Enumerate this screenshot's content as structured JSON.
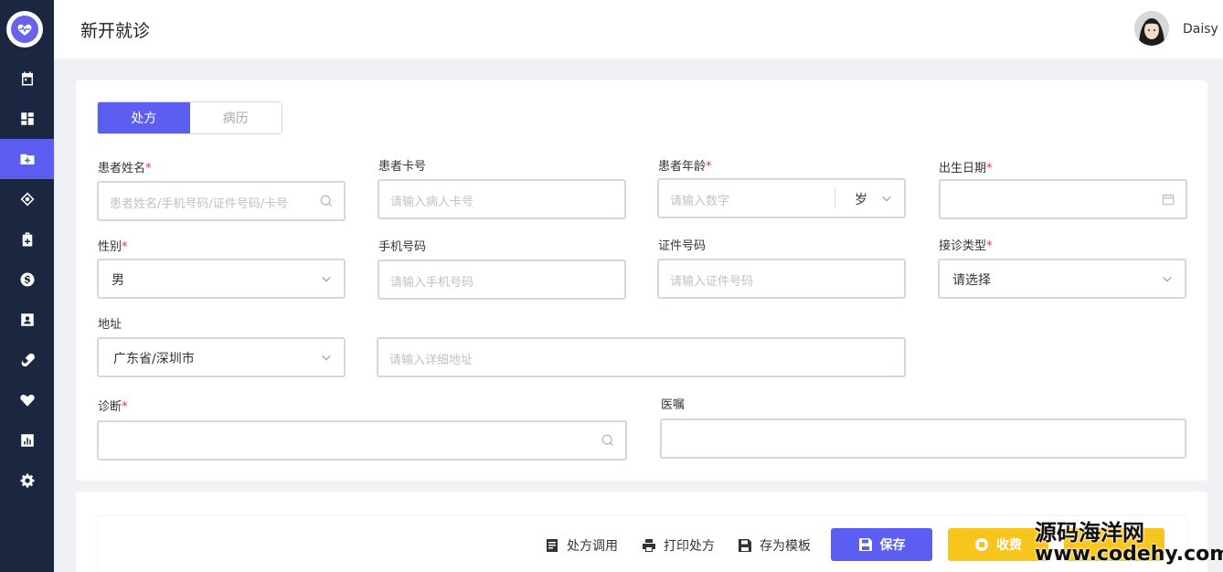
{
  "header": {
    "title": "新开就诊",
    "username": "Daisy"
  },
  "sidebar": {
    "items": [
      {
        "icon": "calendar-icon"
      },
      {
        "icon": "dashboard-icon"
      },
      {
        "icon": "folder-add-icon",
        "active": true
      },
      {
        "icon": "tag-icon"
      },
      {
        "icon": "medical-kit-icon"
      },
      {
        "icon": "dollar-icon"
      },
      {
        "icon": "contact-card-icon"
      },
      {
        "icon": "pill-icon"
      },
      {
        "icon": "heart-icon"
      },
      {
        "icon": "chart-icon"
      },
      {
        "icon": "gear-icon"
      }
    ]
  },
  "tabs": [
    {
      "label": "处方",
      "active": true
    },
    {
      "label": "病历",
      "active": false
    }
  ],
  "form": {
    "patient_name": {
      "label": "患者姓名",
      "required": "*",
      "placeholder": "患者姓名/手机号码/证件号码/卡号"
    },
    "card_no": {
      "label": "患者卡号",
      "placeholder": "请输入病人卡号"
    },
    "age": {
      "label": "患者年龄",
      "required": "*",
      "placeholder": "请输入数字",
      "unit": "岁"
    },
    "birth_date": {
      "label": "出生日期",
      "required": "*"
    },
    "gender": {
      "label": "性别",
      "required": "*",
      "value": "男"
    },
    "phone": {
      "label": "手机号码",
      "placeholder": "请输入手机号码"
    },
    "id_no": {
      "label": "证件号码",
      "placeholder": "请输入证件号码"
    },
    "visit_type": {
      "label": "接诊类型",
      "required": "*",
      "value": "请选择"
    },
    "address": {
      "label": "地址",
      "region": "广东省/深圳市",
      "placeholder": "请输入详细地址"
    },
    "diagnosis": {
      "label": "诊断",
      "required": "*"
    },
    "advice": {
      "label": "医嘱"
    }
  },
  "toolbar": {
    "prescription_call": "处方调用",
    "print": "打印处方",
    "save_template": "存为模板",
    "save": "保存",
    "charge": "收费"
  },
  "watermark": {
    "text": "源码海洋网",
    "url": "www.codehy.com"
  },
  "colors": {
    "accent": "#5b5ef0",
    "sidebar": "#1b2740",
    "warning": "#f8c51c",
    "required": "#e63a3a"
  }
}
